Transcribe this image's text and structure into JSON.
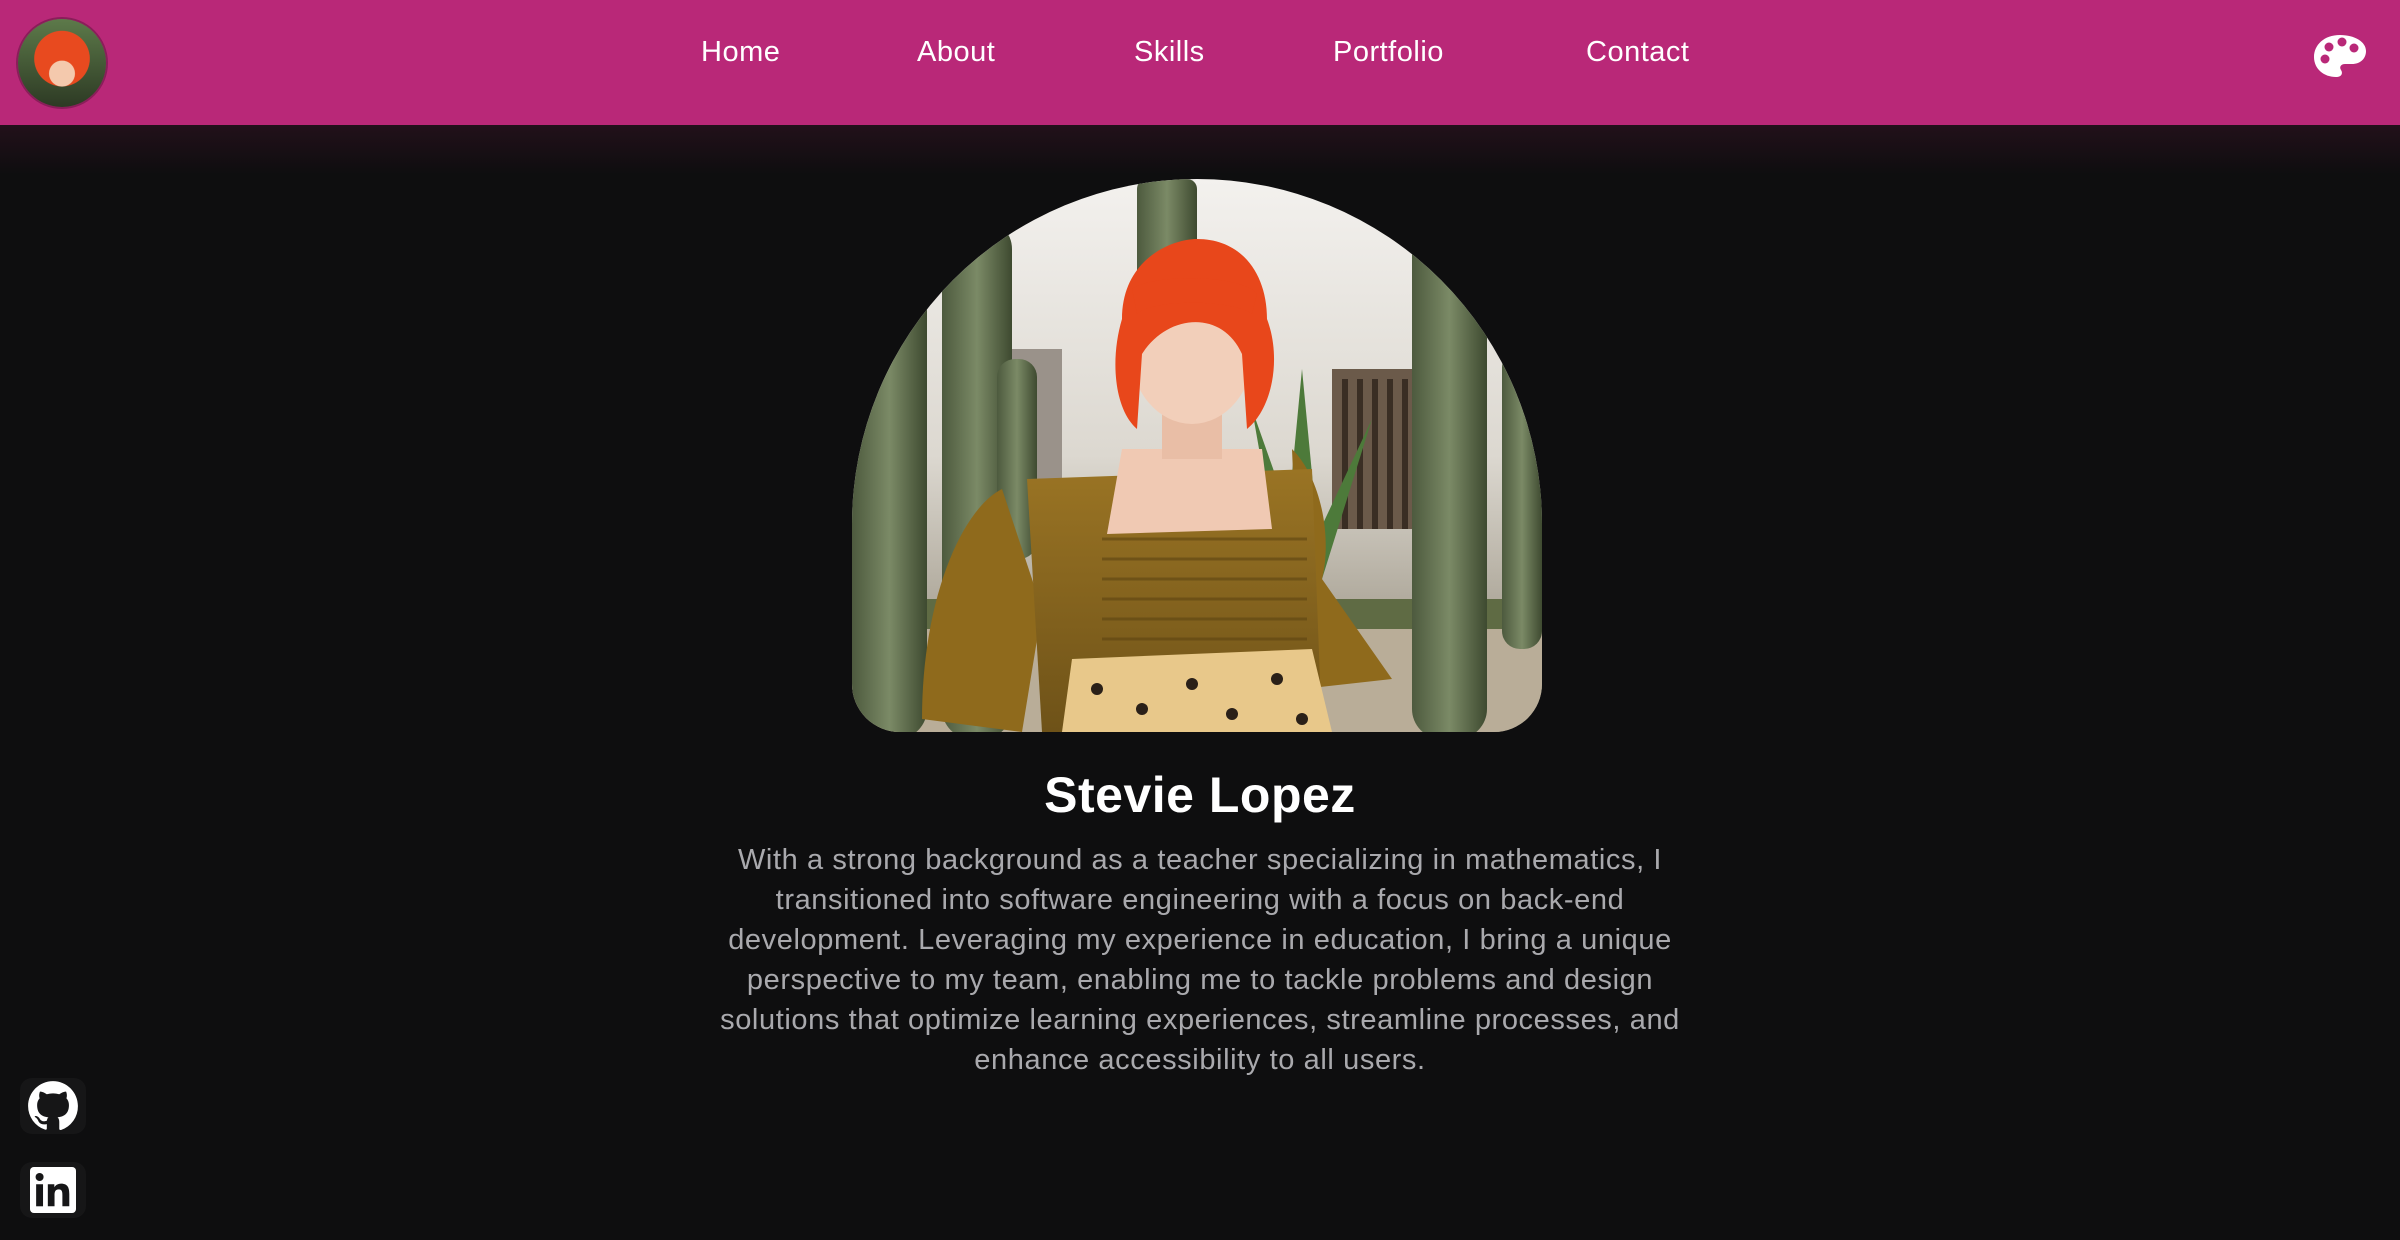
{
  "nav": {
    "links": [
      "Home",
      "About",
      "Skills",
      "Portfolio",
      "Contact"
    ],
    "avatar_alt": "profile avatar",
    "theme_icon": "palette-icon"
  },
  "hero": {
    "name": "Stevie Lopez",
    "bio_lines": [
      "With a strong background as a teacher specializing in mathematics, I",
      "transitioned into software engineering with a focus on back-end",
      "development. Leveraging my experience in education, I bring a unique",
      "perspective to my team, enabling me to tackle problems and design",
      "solutions that optimize learning experiences, streamline processes, and",
      "enhance accessibility to all users."
    ]
  },
  "social": {
    "items": [
      "github-icon",
      "linkedin-icon"
    ]
  },
  "colors": {
    "nav_bg": "#b92878",
    "page_bg": "#0e0e0f",
    "text_primary": "#ffffff",
    "text_muted": "#a9a9ad"
  }
}
